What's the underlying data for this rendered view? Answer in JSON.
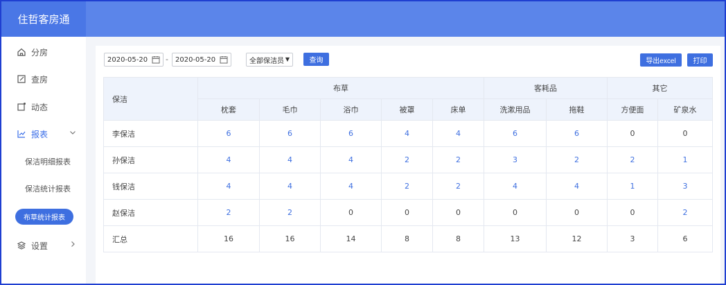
{
  "app": {
    "title": "住哲客房通"
  },
  "colors": {
    "accent": "#3e6fe0",
    "header": "#5b85ea",
    "brand": "#4a77e6"
  },
  "sidebar": {
    "items": [
      {
        "label": "分房",
        "icon": "home-icon"
      },
      {
        "label": "查房",
        "icon": "edit-doc-icon"
      },
      {
        "label": "动态",
        "icon": "dynamic-icon"
      },
      {
        "label": "报表",
        "icon": "chart-line-icon"
      },
      {
        "label": "设置",
        "icon": "layers-icon"
      }
    ],
    "sub_items": [
      {
        "label": "保洁明细报表"
      },
      {
        "label": "保洁统计报表"
      },
      {
        "label": "布草统计报表"
      }
    ]
  },
  "toolbar": {
    "start_date": "2020-05-20",
    "end_date": "2020-05-20",
    "dash": "-",
    "cleaner_select": "全部保洁员",
    "query_label": "查询",
    "export_label": "导出excel",
    "print_label": "打印"
  },
  "table": {
    "col_name_header": "保洁",
    "groups": [
      {
        "label": "布草",
        "span": 5
      },
      {
        "label": "客耗品",
        "span": 2
      },
      {
        "label": "其它",
        "span": 2
      }
    ],
    "columns": [
      "枕套",
      "毛巾",
      "浴巾",
      "被罩",
      "床单",
      "洗漱用品",
      "拖鞋",
      "方便面",
      "矿泉水"
    ],
    "rows": [
      {
        "name": "李保洁",
        "values": [
          "6",
          "6",
          "6",
          "4",
          "4",
          "6",
          "6",
          "0",
          "0"
        ]
      },
      {
        "name": "孙保洁",
        "values": [
          "4",
          "4",
          "4",
          "2",
          "2",
          "3",
          "2",
          "2",
          "1"
        ]
      },
      {
        "name": "钱保洁",
        "values": [
          "4",
          "4",
          "4",
          "2",
          "2",
          "4",
          "4",
          "1",
          "3"
        ]
      },
      {
        "name": "赵保洁",
        "values": [
          "2",
          "2",
          "0",
          "0",
          "0",
          "0",
          "0",
          "0",
          "2"
        ]
      },
      {
        "name": "汇总",
        "values": [
          "16",
          "16",
          "14",
          "8",
          "8",
          "13",
          "12",
          "3",
          "6"
        ]
      }
    ]
  }
}
